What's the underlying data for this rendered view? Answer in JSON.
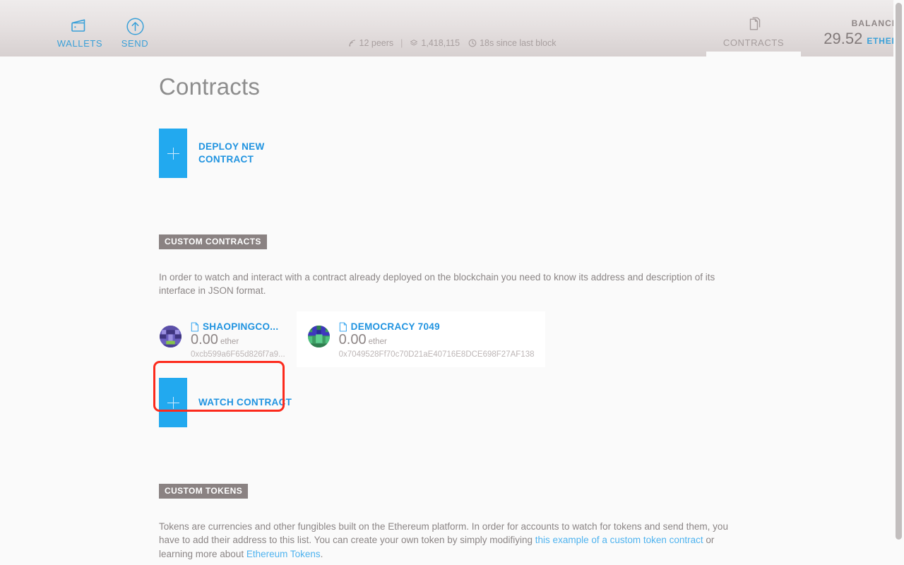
{
  "header": {
    "nav": [
      {
        "label": "WALLETS",
        "icon": "wallet-icon"
      },
      {
        "label": "SEND",
        "icon": "send-arrow-up-circle-icon"
      }
    ],
    "status": {
      "peers": "12 peers",
      "block": "1,418,115",
      "last_block": "18s since last block",
      "separator": "|",
      "peers_icon": "signal-icon",
      "block_icon": "blocks-stack-icon",
      "time_icon": "clock-icon"
    },
    "tab": {
      "label": "CONTRACTS",
      "icon": "documents-icon",
      "active": true
    },
    "balance": {
      "caption": "BALANCE",
      "amount": "29.52",
      "unit": "ETHER"
    }
  },
  "main": {
    "title": "Contracts",
    "deploy": {
      "line1": "DEPLOY NEW",
      "line2": "CONTRACT",
      "plus": "+"
    },
    "custom_contracts": {
      "section_label": "CUSTOM CONTRACTS",
      "description": "In order to watch and interact with a contract already deployed on the blockchain you need to know its address and description of its interface in JSON format.",
      "items": [
        {
          "name": "SHAOPINGCO...",
          "balance": "0.00",
          "unit": "ether",
          "address": "0xcb599a6F65d826f7a9...",
          "avatar_colors": [
            "#5b4fa8",
            "#7b6fc9",
            "#9a8fe0",
            "#3f3580",
            "#86c44a"
          ],
          "hovered": false
        },
        {
          "name": "DEMOCRACY 7049",
          "balance": "0.00",
          "unit": "ether",
          "address": "0x7049528Ff70c70D21aE40716E8DCE698F27AF138",
          "avatar_colors": [
            "#2f7f4f",
            "#3f35c0",
            "#4fc07f",
            "#2a2a9a",
            "#5fd08f"
          ],
          "hovered": true
        }
      ],
      "watch": {
        "label": "WATCH CONTRACT",
        "plus": "+",
        "highlighted": true
      }
    },
    "custom_tokens": {
      "section_label": "CUSTOM TOKENS",
      "text_1": "Tokens are currencies and other fungibles built on the Ethereum platform. In order for accounts to watch for tokens and send them, you have to add their address to this list. You can create your own token by simply modifiying ",
      "link_1": "this example of a custom token contract",
      "text_2": " or learning more about ",
      "link_2": "Ethereum Tokens",
      "text_3": "."
    }
  },
  "colors": {
    "accent_blue": "#22a9ef",
    "link_blue": "#4fb3ef",
    "highlight_red": "#fc2a1c",
    "section_tag_bg": "#8a8282"
  }
}
